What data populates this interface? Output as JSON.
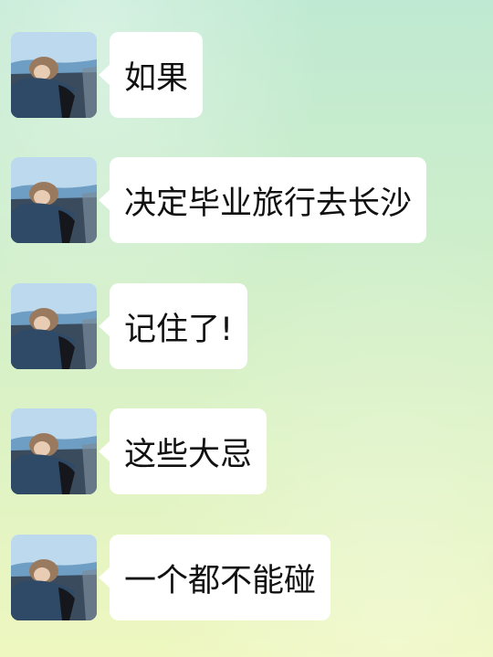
{
  "chat": {
    "messages": [
      {
        "sender_avatar_icon": "user-avatar",
        "text": "如果"
      },
      {
        "sender_avatar_icon": "user-avatar",
        "text": "决定毕业旅行去长沙"
      },
      {
        "sender_avatar_icon": "user-avatar",
        "text": "记住了!"
      },
      {
        "sender_avatar_icon": "user-avatar",
        "text": "这些大忌"
      },
      {
        "sender_avatar_icon": "user-avatar",
        "text": "一个都不能碰"
      }
    ]
  },
  "colors": {
    "bubble_background": "#ffffff",
    "text": "#111111",
    "background_top": "#bfe9d2",
    "background_bottom": "#eef7bf"
  }
}
